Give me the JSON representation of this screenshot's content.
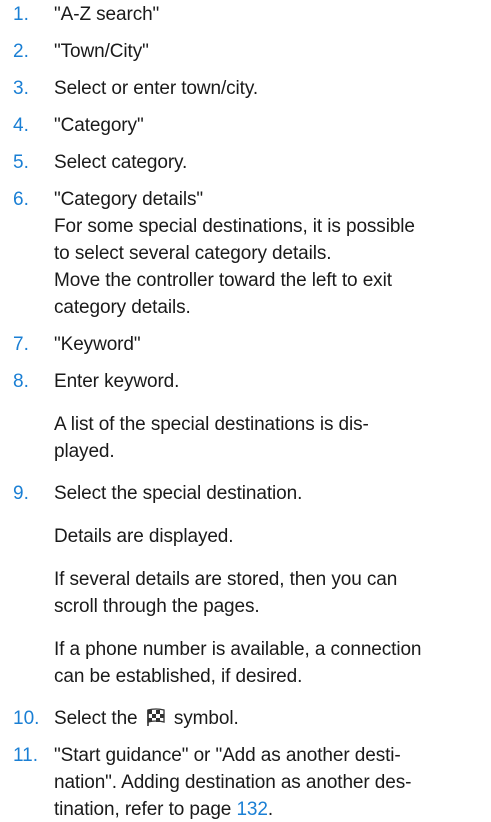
{
  "steps": [
    {
      "num": "1.",
      "text": "\"A-Z search\""
    },
    {
      "num": "2.",
      "text": "\"Town/City\""
    },
    {
      "num": "3.",
      "text": "Select or enter town/city."
    },
    {
      "num": "4.",
      "text": "\"Category\""
    },
    {
      "num": "5.",
      "text": "Select category."
    },
    {
      "num": "6.",
      "lines": [
        "\"Category details\"",
        "For some special destinations, it is possible",
        "to select several category details.",
        "Move the controller toward the left to exit",
        "category details."
      ]
    },
    {
      "num": "7.",
      "text": "\"Keyword\""
    },
    {
      "num": "8.",
      "text": "Enter keyword.",
      "notes": [
        "A list of the special destinations is dis-",
        "played."
      ]
    },
    {
      "num": "9.",
      "text": "Select the special destination.",
      "notes": [
        "Details are displayed.",
        "If several details are stored, then you can",
        "scroll through the pages.",
        "If a phone number is available, a connection",
        "can be established, if desired."
      ]
    },
    {
      "num": "10.",
      "text_before": "Select the",
      "icon": "checkered-flag-icon",
      "text_after": "symbol."
    },
    {
      "num": "11.",
      "lines": [
        "\"Start guidance\" or \"Add as another desti-",
        "nation\". Adding destination as another des-"
      ],
      "last_line_prefix": "tination, refer to page",
      "page_ref": "132",
      "last_line_suffix": "."
    }
  ],
  "colors": {
    "accent": "#1a7fd4",
    "text": "#1a1a1a"
  }
}
